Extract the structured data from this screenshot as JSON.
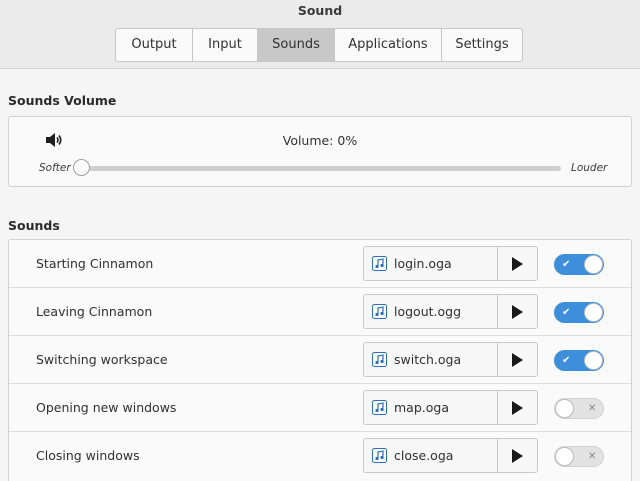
{
  "window": {
    "title": "Sound"
  },
  "tabs": [
    {
      "label": "Output",
      "active": false
    },
    {
      "label": "Input",
      "active": false
    },
    {
      "label": "Sounds",
      "active": true
    },
    {
      "label": "Applications",
      "active": false
    },
    {
      "label": "Settings",
      "active": false
    }
  ],
  "volume_section": {
    "title": "Sounds Volume",
    "volume_label": "Volume: 0%",
    "volume_fraction": 0,
    "softer_label": "Softer",
    "louder_label": "Louder",
    "speaker_icon": "speaker-icon"
  },
  "sounds_section": {
    "title": "Sounds",
    "rows": [
      {
        "label": "Starting Cinnamon",
        "file": "login.oga",
        "enabled": true
      },
      {
        "label": "Leaving Cinnamon",
        "file": "logout.ogg",
        "enabled": true
      },
      {
        "label": "Switching workspace",
        "file": "switch.oga",
        "enabled": true
      },
      {
        "label": "Opening new windows",
        "file": "map.oga",
        "enabled": false
      },
      {
        "label": "Closing windows",
        "file": "close.oga",
        "enabled": false
      }
    ]
  },
  "colors": {
    "accent": "#3d8fdb",
    "file_icon": "#2d6fb8"
  },
  "icons": {
    "file": "music-note-icon",
    "play": "play-icon",
    "toggle_on_mark": "✔",
    "toggle_off_mark": "✕"
  }
}
